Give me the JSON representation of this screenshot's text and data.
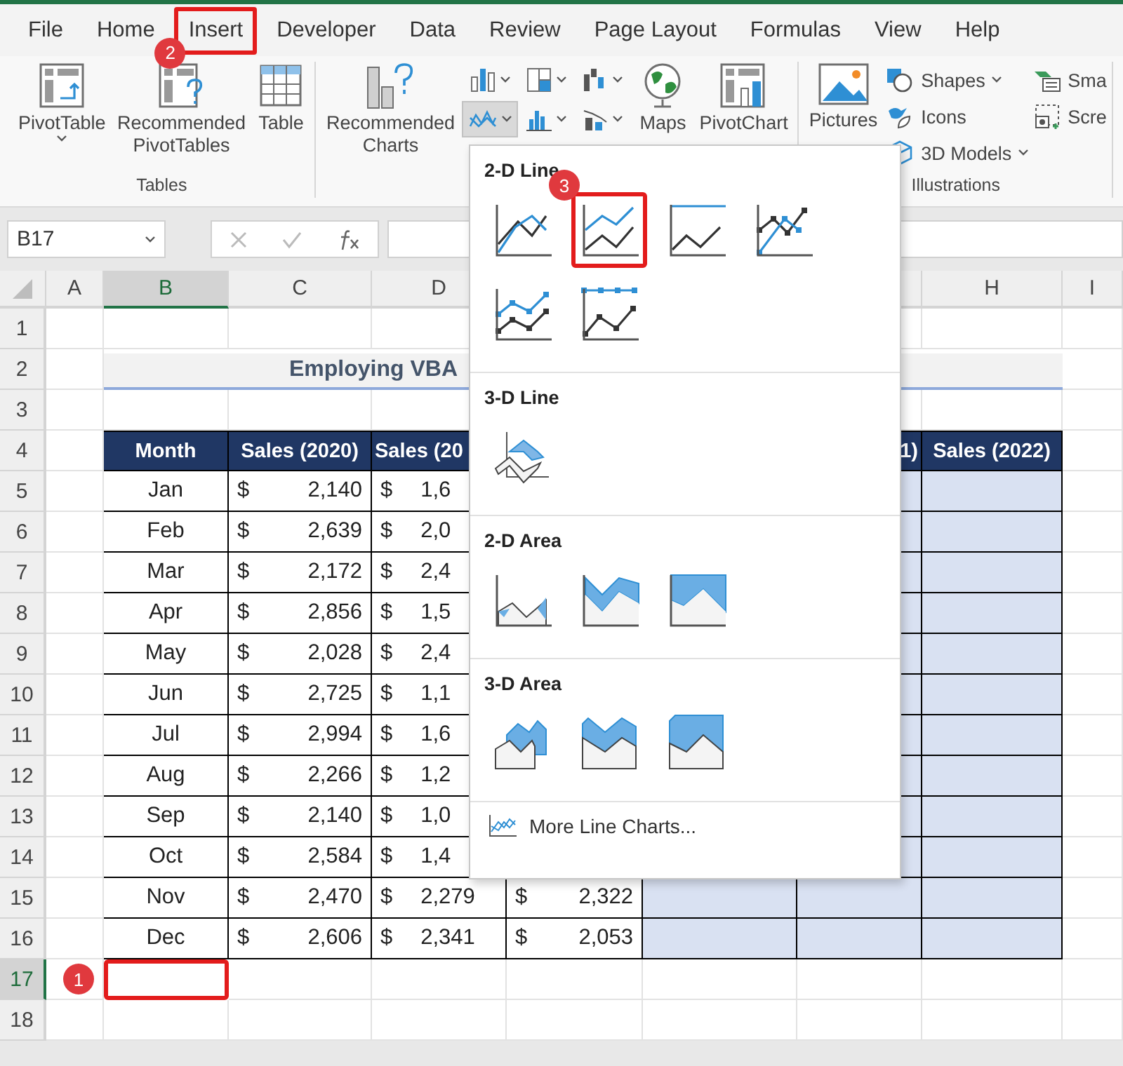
{
  "tabs": [
    {
      "label": "File",
      "highlighted": false
    },
    {
      "label": "Home",
      "highlighted": false
    },
    {
      "label": "Insert",
      "highlighted": true,
      "step": "2"
    },
    {
      "label": "Developer",
      "highlighted": false
    },
    {
      "label": "Data",
      "highlighted": false
    },
    {
      "label": "Review",
      "highlighted": false
    },
    {
      "label": "Page Layout",
      "highlighted": false
    },
    {
      "label": "Formulas",
      "highlighted": false
    },
    {
      "label": "View",
      "highlighted": false
    },
    {
      "label": "Help",
      "highlighted": false
    }
  ],
  "ribbon": {
    "groups": [
      {
        "label": "Tables",
        "items": [
          {
            "kind": "large",
            "label": "PivotTable",
            "menu": true
          },
          {
            "kind": "large",
            "label": "Recommended PivotTables",
            "menu": false
          },
          {
            "kind": "large",
            "label": "Table",
            "menu": false
          }
        ]
      },
      {
        "items": [
          {
            "kind": "large",
            "label": "Recommended Charts",
            "menu": false
          },
          {
            "kind": "grid",
            "buttons": [
              {
                "selected": false
              },
              {
                "selected": false
              },
              {
                "selected": false
              },
              {
                "selected": true
              },
              {
                "selected": false
              },
              {
                "selected": false
              }
            ]
          },
          {
            "kind": "large",
            "label": "Maps",
            "menu": false
          },
          {
            "kind": "large",
            "label": "PivotChart",
            "menu": false
          }
        ]
      },
      {
        "label": "Illustrations",
        "items": [
          {
            "kind": "large",
            "label": "Pictures",
            "menu": false
          },
          {
            "kind": "stack",
            "buttons": [
              {
                "label": "Shapes",
                "menu": true
              },
              {
                "label": "Icons",
                "menu": false
              },
              {
                "label": "3D Models",
                "menu": true
              }
            ]
          },
          {
            "kind": "stack",
            "buttons": [
              {
                "label": "Sma",
                "menu": false
              },
              {
                "label": "Scre",
                "menu": false
              }
            ]
          }
        ]
      }
    ]
  },
  "formula_bar": {
    "name_box": "B17"
  },
  "sheet": {
    "columns": [
      {
        "label": "A",
        "selected": false
      },
      {
        "label": "B",
        "selected": true
      },
      {
        "label": "C",
        "selected": false
      },
      {
        "label": "D",
        "selected": false
      },
      {
        "label": "H",
        "selected": false
      },
      {
        "label": "I",
        "selected": false
      }
    ],
    "rows": [
      {
        "number": "1",
        "selected": false,
        "kind": "blank"
      },
      {
        "number": "2",
        "selected": false,
        "kind": "title",
        "text": "Employing VBA"
      },
      {
        "number": "3",
        "selected": false,
        "kind": "blank"
      },
      {
        "number": "4",
        "selected": false,
        "kind": "header",
        "headers": [
          "Month",
          "Sales (2020)",
          "Sales (20",
          "1)",
          "Sales (2022)"
        ]
      },
      {
        "number": "5",
        "selected": false,
        "kind": "data",
        "month": "Jan",
        "values": [
          {
            "currency": "$",
            "amount": "2,140"
          },
          {
            "currency": "$",
            "amount": "1,6"
          }
        ]
      },
      {
        "number": "6",
        "selected": false,
        "kind": "data",
        "month": "Feb",
        "values": [
          {
            "currency": "$",
            "amount": "2,639"
          },
          {
            "currency": "$",
            "amount": "2,0"
          }
        ]
      },
      {
        "number": "7",
        "selected": false,
        "kind": "data",
        "month": "Mar",
        "values": [
          {
            "currency": "$",
            "amount": "2,172"
          },
          {
            "currency": "$",
            "amount": "2,4"
          }
        ]
      },
      {
        "number": "8",
        "selected": false,
        "kind": "data",
        "month": "Apr",
        "values": [
          {
            "currency": "$",
            "amount": "2,856"
          },
          {
            "currency": "$",
            "amount": "1,5"
          }
        ]
      },
      {
        "number": "9",
        "selected": false,
        "kind": "data",
        "month": "May",
        "values": [
          {
            "currency": "$",
            "amount": "2,028"
          },
          {
            "currency": "$",
            "amount": "2,4"
          }
        ]
      },
      {
        "number": "10",
        "selected": false,
        "kind": "data",
        "month": "Jun",
        "values": [
          {
            "currency": "$",
            "amount": "2,725"
          },
          {
            "currency": "$",
            "amount": "1,1"
          }
        ]
      },
      {
        "number": "11",
        "selected": false,
        "kind": "data",
        "month": "Jul",
        "values": [
          {
            "currency": "$",
            "amount": "2,994"
          },
          {
            "currency": "$",
            "amount": "1,6"
          }
        ]
      },
      {
        "number": "12",
        "selected": false,
        "kind": "data",
        "month": "Aug",
        "values": [
          {
            "currency": "$",
            "amount": "2,266"
          },
          {
            "currency": "$",
            "amount": "1,2"
          }
        ]
      },
      {
        "number": "13",
        "selected": false,
        "kind": "data",
        "month": "Sep",
        "values": [
          {
            "currency": "$",
            "amount": "2,140"
          },
          {
            "currency": "$",
            "amount": "1,0"
          }
        ]
      },
      {
        "number": "14",
        "selected": false,
        "kind": "data",
        "month": "Oct",
        "values": [
          {
            "currency": "$",
            "amount": "2,584"
          },
          {
            "currency": "$",
            "amount": "1,4"
          }
        ]
      },
      {
        "number": "15",
        "selected": false,
        "kind": "data",
        "month": "Nov",
        "values": [
          {
            "currency": "$",
            "amount": "2,470"
          },
          {
            "currency": "$",
            "amount": "2,279"
          },
          {
            "currency": "$",
            "amount": "2,322"
          }
        ]
      },
      {
        "number": "16",
        "selected": false,
        "kind": "data",
        "month": "Dec",
        "values": [
          {
            "currency": "$",
            "amount": "2,606"
          },
          {
            "currency": "$",
            "amount": "2,341"
          },
          {
            "currency": "$",
            "amount": "2,053"
          }
        ]
      },
      {
        "number": "17",
        "selected": true,
        "kind": "active",
        "highlighted": true,
        "step": "1"
      },
      {
        "number": "18",
        "selected": false,
        "kind": "blank"
      }
    ]
  },
  "chart_menu": {
    "sections": [
      {
        "title": "2-D Line",
        "options": [
          {
            "kind": "line",
            "highlighted": false
          },
          {
            "kind": "stacked-line",
            "highlighted": true,
            "step": "3"
          },
          {
            "kind": "pct-line",
            "highlighted": false
          },
          {
            "kind": "line-markers",
            "highlighted": false
          },
          {
            "kind": "stacked-line-markers",
            "highlighted": false
          },
          {
            "kind": "pct-line-markers",
            "highlighted": false
          }
        ]
      },
      {
        "title": "3-D Line",
        "options": [
          {
            "kind": "line-3d",
            "highlighted": false
          }
        ]
      },
      {
        "title": "2-D Area",
        "options": [
          {
            "kind": "area",
            "highlighted": false
          },
          {
            "kind": "stacked-area",
            "highlighted": false
          },
          {
            "kind": "pct-area",
            "highlighted": false
          }
        ]
      },
      {
        "title": "3-D Area",
        "options": [
          {
            "kind": "area-3d",
            "highlighted": false
          },
          {
            "kind": "stacked-area-3d",
            "highlighted": false
          },
          {
            "kind": "pct-area-3d",
            "highlighted": false
          }
        ]
      }
    ],
    "more": "More Line Charts..."
  }
}
